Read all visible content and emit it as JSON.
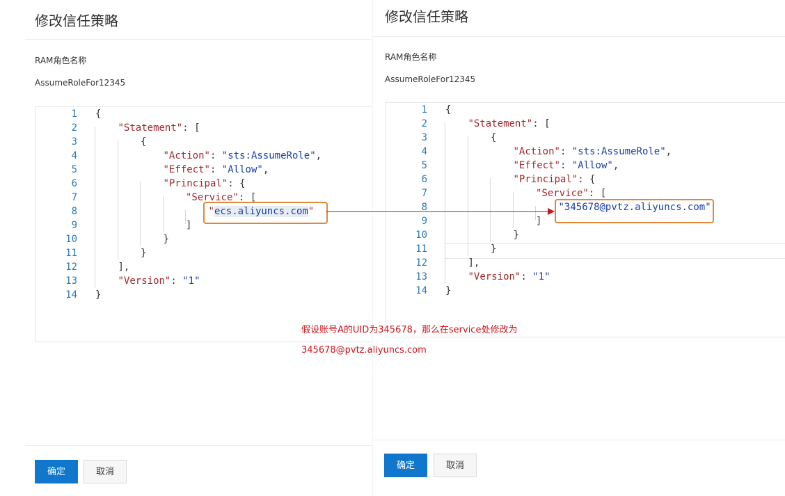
{
  "left": {
    "title": "修改信任策略",
    "role_label": "RAM角色名称",
    "role_value": "AssumeRoleFor12345",
    "code_lines": [
      {
        "n": "1",
        "text": "{"
      },
      {
        "n": "2",
        "key": "\"Statement\"",
        "rest": ": ["
      },
      {
        "n": "3",
        "text": "{"
      },
      {
        "n": "4",
        "key": "\"Action\"",
        "mid": ": ",
        "str": "\"sts:AssumeRole\"",
        "rest": ","
      },
      {
        "n": "5",
        "key": "\"Effect\"",
        "mid": ": ",
        "str": "\"Allow\"",
        "rest": ","
      },
      {
        "n": "6",
        "key": "\"Principal\"",
        "rest": ": {"
      },
      {
        "n": "7",
        "key": "\"Service\"",
        "rest": ": ["
      },
      {
        "n": "8",
        "q": "\"",
        "str": "ecs.aliyuncs.com",
        "q2": "\""
      },
      {
        "n": "9",
        "text": "]"
      },
      {
        "n": "10",
        "text": "}"
      },
      {
        "n": "11",
        "text": "}"
      },
      {
        "n": "12",
        "text": "],"
      },
      {
        "n": "13",
        "key": "\"Version\"",
        "mid": ": ",
        "str": "\"1\""
      },
      {
        "n": "14",
        "text": "}"
      }
    ],
    "ok_label": "确定",
    "cancel_label": "取消"
  },
  "right": {
    "title": "修改信任策略",
    "role_label": "RAM角色名称",
    "role_value": "AssumeRoleFor12345",
    "code_lines": [
      {
        "n": "1",
        "text": "{"
      },
      {
        "n": "2",
        "key": "\"Statement\"",
        "rest": ": ["
      },
      {
        "n": "3",
        "text": "{"
      },
      {
        "n": "4",
        "key": "\"Action\"",
        "mid": ": ",
        "str": "\"sts:AssumeRole\"",
        "rest": ","
      },
      {
        "n": "5",
        "key": "\"Effect\"",
        "mid": ": ",
        "str": "\"Allow\"",
        "rest": ","
      },
      {
        "n": "6",
        "key": "\"Principal\"",
        "rest": ": {"
      },
      {
        "n": "7",
        "key": "\"Service\"",
        "rest": ": ["
      },
      {
        "n": "8",
        "str": "\"345678@pvtz.aliyuncs.com\""
      },
      {
        "n": "9",
        "text": "]"
      },
      {
        "n": "10",
        "text": "}"
      },
      {
        "n": "11",
        "text": "}"
      },
      {
        "n": "12",
        "text": "],"
      },
      {
        "n": "13",
        "key": "\"Version\"",
        "mid": ": ",
        "str": "\"1\""
      },
      {
        "n": "14",
        "text": "}"
      }
    ],
    "ok_label": "确定",
    "cancel_label": "取消"
  },
  "annotation": {
    "line1": "假设账号A的UID为345678，那么在service处修改为",
    "line2": "345678@pvtz.aliyuncs.com"
  },
  "colors": {
    "primary": "#1177cc",
    "highlight_box": "#e0883a",
    "annotation": "#d0131a",
    "json_key": "#a3252a",
    "json_string": "#1a3fa8",
    "line_number": "#2b7bb5"
  }
}
